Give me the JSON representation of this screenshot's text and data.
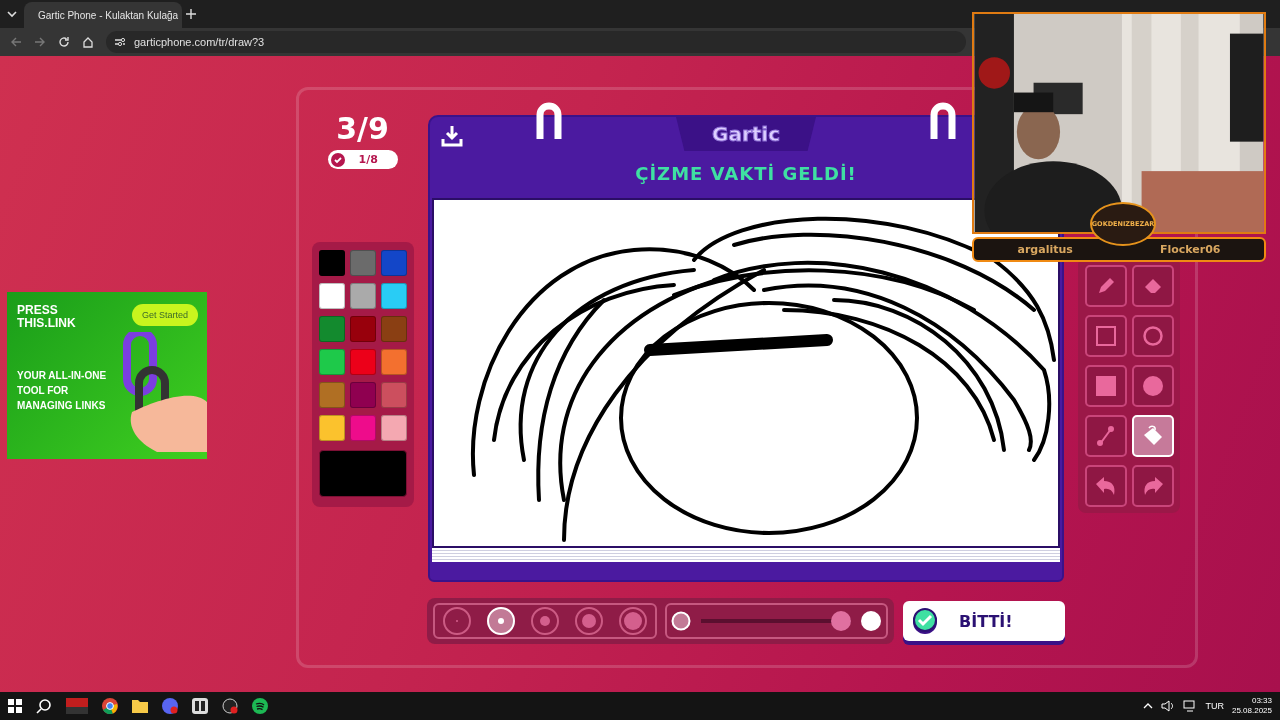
{
  "browser": {
    "tab": {
      "title": "Gartic Phone - Kulaktan Kulağa"
    },
    "address": "garticphone.com/tr/draw?3"
  },
  "ad": {
    "headline": "PRESS THIS.LINK",
    "button": "Get Started",
    "tagline": "YOUR ALL-IN-ONE TOOL FOR MANAGING LINKS"
  },
  "game": {
    "round": "3/9",
    "done_count": "1/8",
    "logo": "Gartic",
    "heading": "ÇİZME VAKTİ GELDİ!",
    "palette": [
      {
        "color": "#000000",
        "selected": true
      },
      {
        "color": "#6b6b6b"
      },
      {
        "color": "#1346c8"
      },
      {
        "color": "#ffffff"
      },
      {
        "color": "#aaaaaa"
      },
      {
        "color": "#29ccf5"
      },
      {
        "color": "#138a2e"
      },
      {
        "color": "#98000c"
      },
      {
        "color": "#8a3f13"
      },
      {
        "color": "#1ec94a"
      },
      {
        "color": "#ec0019"
      },
      {
        "color": "#f3702f"
      },
      {
        "color": "#b06f23"
      },
      {
        "color": "#8f0050"
      },
      {
        "color": "#cc4f5e"
      },
      {
        "color": "#fbc22d"
      },
      {
        "color": "#ee0c8b"
      },
      {
        "color": "#f4a8b1"
      }
    ],
    "tools": [
      {
        "kind": "pencil",
        "selected": false
      },
      {
        "kind": "eraser",
        "selected": false
      },
      {
        "kind": "rect",
        "selected": false
      },
      {
        "kind": "circle",
        "selected": false
      },
      {
        "kind": "rect-fill",
        "selected": false
      },
      {
        "kind": "circle-fill",
        "selected": false
      },
      {
        "kind": "line",
        "selected": false
      },
      {
        "kind": "bucket",
        "selected": true
      },
      {
        "kind": "undo",
        "selected": false
      },
      {
        "kind": "redo",
        "selected": false
      }
    ],
    "brush_sizes": [
      {
        "selected": false
      },
      {
        "selected": true
      },
      {
        "selected": false
      },
      {
        "selected": false
      },
      {
        "selected": false
      }
    ],
    "opacity": {
      "level": 1
    },
    "done_button": "BİTTİ!"
  },
  "stream_overlay": {
    "badge": "GOKDENIZBEZAR",
    "names": [
      "argalitus",
      "Flocker06"
    ]
  },
  "taskbar": {
    "language": "TUR",
    "time": "03:33",
    "date": "25.08.2025"
  }
}
